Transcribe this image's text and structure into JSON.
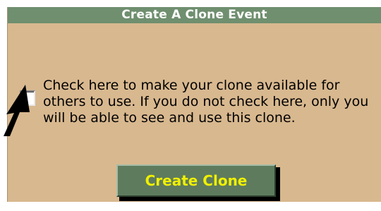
{
  "dialog": {
    "title": "Create A Clone Event",
    "checkbox_label": "Check here to make your clone available for others to use. If you do not check here, only you will be able to see and use this clone.",
    "checkbox_checked": false,
    "create_button_label": "Create Clone"
  },
  "icons": {
    "pointer": "mouse-pointer-arrow-icon"
  },
  "colors": {
    "panel_background": "#d8b88f",
    "title_bar_background": "#6f8f6f",
    "title_text": "#ffffff",
    "button_background": "#5e7b5e",
    "button_text": "#f0f000"
  }
}
